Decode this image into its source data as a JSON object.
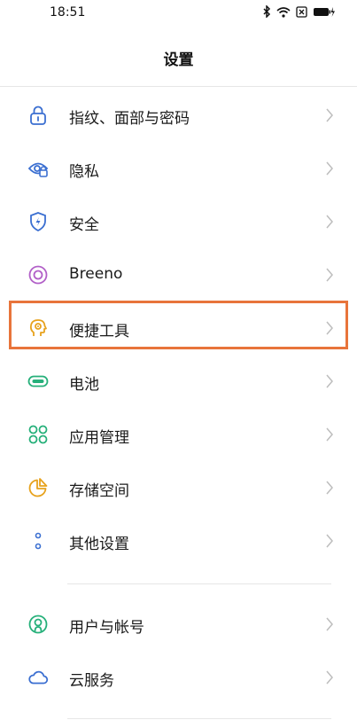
{
  "status_bar": {
    "time": "18:51"
  },
  "header": {
    "title": "设置"
  },
  "menu": {
    "items": [
      {
        "label": "指纹、面部与密码",
        "icon": "lock-icon",
        "color": "#3b6fd1"
      },
      {
        "label": "隐私",
        "icon": "eye-lock-icon",
        "color": "#3b6fd1"
      },
      {
        "label": "安全",
        "icon": "shield-bolt-icon",
        "color": "#3b6fd1"
      },
      {
        "label": "Breeno",
        "icon": "breeno-circle-icon",
        "color": "#b260c8"
      },
      {
        "label": "便捷工具",
        "icon": "head-tools-icon",
        "color": "#e7a21d"
      },
      {
        "label": "电池",
        "icon": "battery-icon",
        "color": "#26b07a"
      },
      {
        "label": "应用管理",
        "icon": "apps-grid-icon",
        "color": "#26b07a"
      },
      {
        "label": "存储空间",
        "icon": "pie-storage-icon",
        "color": "#e7a21d"
      },
      {
        "label": "其他设置",
        "icon": "dots-icon",
        "color": "#3b6fd1"
      }
    ],
    "items2": [
      {
        "label": "用户与帐号",
        "icon": "user-icon",
        "color": "#26b07a"
      },
      {
        "label": "云服务",
        "icon": "cloud-icon",
        "color": "#3b6fd1"
      }
    ]
  },
  "highlight_color": "#e8743b"
}
